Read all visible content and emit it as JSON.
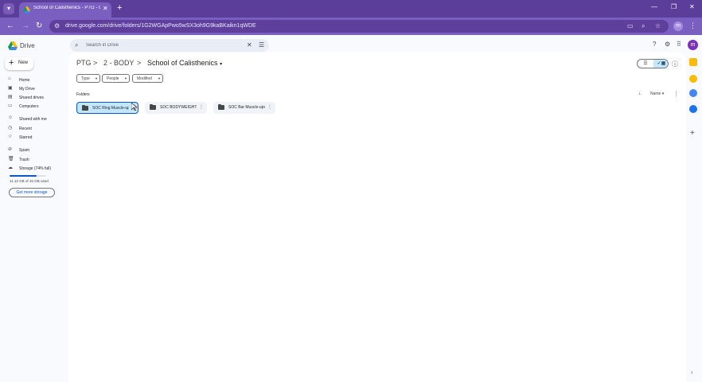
{
  "browser": {
    "tab_title": "School of Calisthenics - PTG - Google Drive",
    "tab_close": "✕",
    "new_tab": "+",
    "url": "drive.google.com/drive/folders/1G2WGApPwo5wSX3oh9G9kaBKaikn1qWDE",
    "profile_initial": "m",
    "window_controls": [
      "—",
      "❐",
      "✕"
    ]
  },
  "drive": {
    "logo_text": "Drive",
    "search": {
      "placeholder": "Search in Drive"
    },
    "avatar_initial": "m",
    "new_button": "New",
    "nav": [
      {
        "label": "Home",
        "icon": "home-icon"
      },
      {
        "label": "My Drive",
        "icon": "my-drive-icon"
      },
      {
        "label": "Shared drives",
        "icon": "shared-drives-icon"
      },
      {
        "label": "Computers",
        "icon": "computers-icon"
      },
      {
        "label": "Shared with me",
        "icon": "shared-with-me-icon"
      },
      {
        "label": "Recent",
        "icon": "recent-icon"
      },
      {
        "label": "Starred",
        "icon": "starred-icon"
      },
      {
        "label": "Spam",
        "icon": "spam-icon"
      },
      {
        "label": "Trash",
        "icon": "trash-icon"
      },
      {
        "label": "Storage (74% full)",
        "icon": "storage-icon"
      }
    ],
    "storage": {
      "used_text": "11.12 GB of 15 GB used",
      "fraction": 0.74
    },
    "get_storage": "Get more storage",
    "breadcrumb": {
      "items": [
        "PTG",
        "2 - BODY",
        "School of Calisthenics"
      ],
      "separator": ">"
    },
    "filters": [
      {
        "label": "Type"
      },
      {
        "label": "People"
      },
      {
        "label": "Modified"
      }
    ],
    "folders_label": "Folders",
    "sort_label": "Name",
    "folders": [
      {
        "name": "SOC Ring Muscle-ups",
        "selected": true
      },
      {
        "name": "SOC BODYWEIGHT",
        "selected": false
      },
      {
        "name": "SOC Bar Muscle-ups",
        "selected": false
      }
    ],
    "colors": {
      "accent": "#0b57d0",
      "selected_bg": "#c2e7ff",
      "chrome": "#7b5fc0"
    }
  }
}
